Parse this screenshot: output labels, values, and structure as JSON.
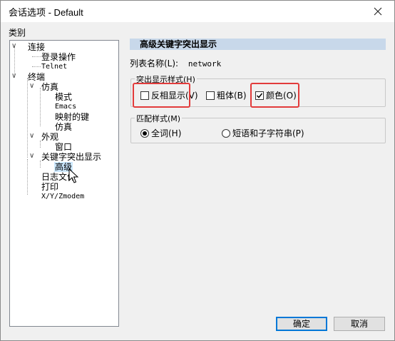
{
  "window": {
    "title": "会话选项 - Default"
  },
  "sidebar": {
    "label": "类别",
    "items": [
      {
        "label": "连接",
        "level": 1
      },
      {
        "label": "登录操作",
        "level": 2
      },
      {
        "label": "Telnet",
        "level": 2
      },
      {
        "label": "终端",
        "level": 1
      },
      {
        "label": "仿真",
        "level": 2
      },
      {
        "label": "模式",
        "level": 3
      },
      {
        "label": "Emacs",
        "level": 3
      },
      {
        "label": "映射的键",
        "level": 3
      },
      {
        "label": "仿真",
        "level": 3
      },
      {
        "label": "外观",
        "level": 2
      },
      {
        "label": "窗口",
        "level": 3
      },
      {
        "label": "关键字突出显示",
        "level": 2
      },
      {
        "label": "高级",
        "level": 3,
        "selected": true
      },
      {
        "label": "日志文件",
        "level": 2
      },
      {
        "label": "打印",
        "level": 2
      },
      {
        "label": "X/Y/Zmodem",
        "level": 2
      }
    ]
  },
  "panel": {
    "header": "高级关键字突出显示",
    "list_name_label": "列表名称(L):",
    "list_name_value": "network",
    "highlight_group": {
      "title": "突出显示样式(H)",
      "reverse": {
        "label": "反相显示(V)",
        "checked": false
      },
      "bold": {
        "label": "粗体(B)",
        "checked": false
      },
      "color": {
        "label": "颜色(O)",
        "checked": true
      }
    },
    "match_group": {
      "title": "匹配样式(M)",
      "whole_word": {
        "label": "全词(H)",
        "selected": true
      },
      "substring": {
        "label": "短语和子字符串(P)",
        "selected": false
      }
    }
  },
  "buttons": {
    "ok": "确定",
    "cancel": "取消"
  },
  "colors": {
    "header_bg": "#c8d8ea",
    "annotation_red": "#e23b3b",
    "default_button_border": "#0078d7"
  }
}
